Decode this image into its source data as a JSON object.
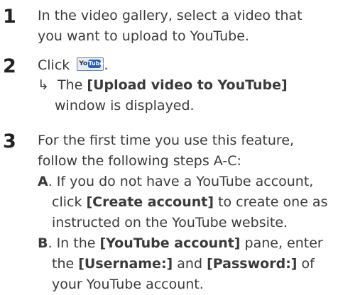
{
  "steps": [
    {
      "number": "1",
      "line1": "In the video gallery, select a video that",
      "line2": "you want to upload to YouTube."
    },
    {
      "number": "2",
      "text_before": "Click",
      "after_icon": ".",
      "icon": {
        "name": "youtube-upload-icon",
        "label_you": "You",
        "label_tube": "Tube"
      },
      "result": {
        "arrow": "↳",
        "prefix": "The",
        "window_name": "[Upload video to YouTube]",
        "suffix": "window is displayed."
      }
    },
    {
      "number": "3",
      "line1": "For the first time you use this feature,",
      "line2": "follow the following steps A-C:",
      "sub_a": {
        "label": "A",
        "line1": ". If you do not have a YouTube account,",
        "line2_prefix": "click",
        "line2_bold": "[Create account]",
        "line2_suffix": "to create one as",
        "line3": "instructed on the YouTube website."
      },
      "sub_b": {
        "label": "B",
        "line1_prefix": ". In the",
        "line1_bold": "[YouTube account]",
        "line1_suffix": "pane, enter",
        "line2_prefix": "the",
        "line2_bold1": "[Username:]",
        "line2_mid": "and",
        "line2_bold2": "[Password:]",
        "line2_suffix": "of",
        "line3": "your YouTube account."
      }
    }
  ]
}
